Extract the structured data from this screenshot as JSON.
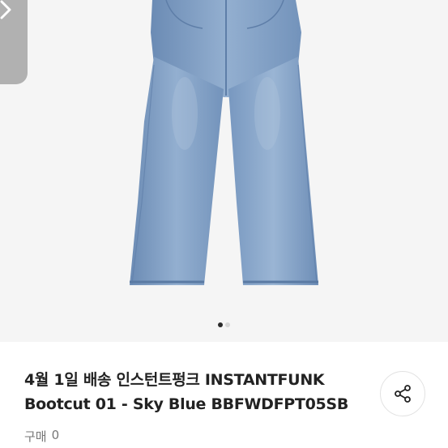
{
  "product": {
    "title_line1": "4월 1일 배송 인스턴트펑크 INSTANTFUNK",
    "title_line2": "Bootcut 01 - Sky Blue BBFWDFPT05SB",
    "purchase_label": "구매",
    "purchase_count": "0"
  },
  "gallery": {
    "total_images": 2,
    "current_image": 1
  },
  "icons": {
    "back": "chevron-right-icon",
    "share": "share-icon"
  },
  "colors": {
    "denim": "#7f9dc2",
    "background": "#f5f5f5",
    "text": "#222222",
    "muted": "#777777"
  }
}
